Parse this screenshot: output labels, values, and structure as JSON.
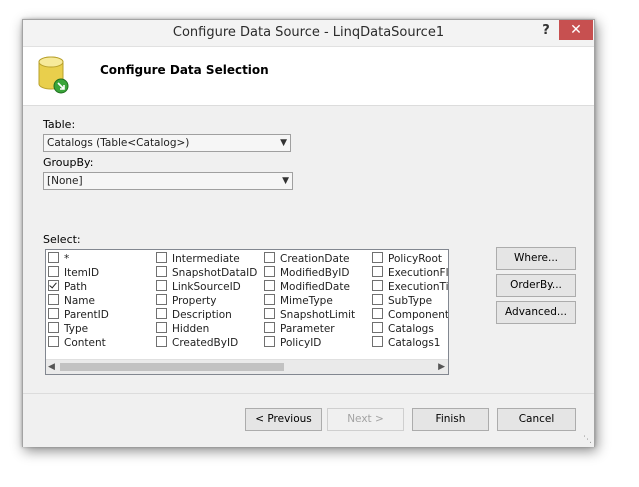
{
  "window": {
    "title": "Configure Data Source - LinqDataSource1",
    "help_label": "?",
    "close_label": "✕"
  },
  "header": {
    "title": "Configure Data Selection",
    "icon": "database-icon"
  },
  "table": {
    "label": "Table:",
    "value": "Catalogs (Table<Catalog>)"
  },
  "groupby": {
    "label": "GroupBy:",
    "value": "[None]"
  },
  "select": {
    "label": "Select:",
    "columns": [
      [
        {
          "label": "*",
          "checked": false
        },
        {
          "label": "ItemID",
          "checked": false
        },
        {
          "label": "Path",
          "checked": true
        },
        {
          "label": "Name",
          "checked": false
        },
        {
          "label": "ParentID",
          "checked": false
        },
        {
          "label": "Type",
          "checked": false
        },
        {
          "label": "Content",
          "checked": false
        }
      ],
      [
        {
          "label": "Intermediate",
          "checked": false
        },
        {
          "label": "SnapshotDataID",
          "checked": false
        },
        {
          "label": "LinkSourceID",
          "checked": false
        },
        {
          "label": "Property",
          "checked": false
        },
        {
          "label": "Description",
          "checked": false
        },
        {
          "label": "Hidden",
          "checked": false
        },
        {
          "label": "CreatedByID",
          "checked": false
        }
      ],
      [
        {
          "label": "CreationDate",
          "checked": false
        },
        {
          "label": "ModifiedByID",
          "checked": false
        },
        {
          "label": "ModifiedDate",
          "checked": false
        },
        {
          "label": "MimeType",
          "checked": false
        },
        {
          "label": "SnapshotLimit",
          "checked": false
        },
        {
          "label": "Parameter",
          "checked": false
        },
        {
          "label": "PolicyID",
          "checked": false
        }
      ],
      [
        {
          "label": "PolicyRoot",
          "checked": false
        },
        {
          "label": "ExecutionFlag",
          "checked": false
        },
        {
          "label": "ExecutionTime",
          "checked": false
        },
        {
          "label": "SubType",
          "checked": false
        },
        {
          "label": "ComponentID",
          "checked": false
        },
        {
          "label": "Catalogs",
          "checked": false
        },
        {
          "label": "Catalogs1",
          "checked": false
        }
      ]
    ]
  },
  "side_buttons": {
    "where": "Where...",
    "orderby": "OrderBy...",
    "advanced": "Advanced..."
  },
  "footer_buttons": {
    "previous": "< Previous",
    "next": "Next >",
    "finish": "Finish",
    "cancel": "Cancel"
  },
  "colors": {
    "close_button": "#c75050",
    "dialog_bg": "#f0f0f0"
  }
}
